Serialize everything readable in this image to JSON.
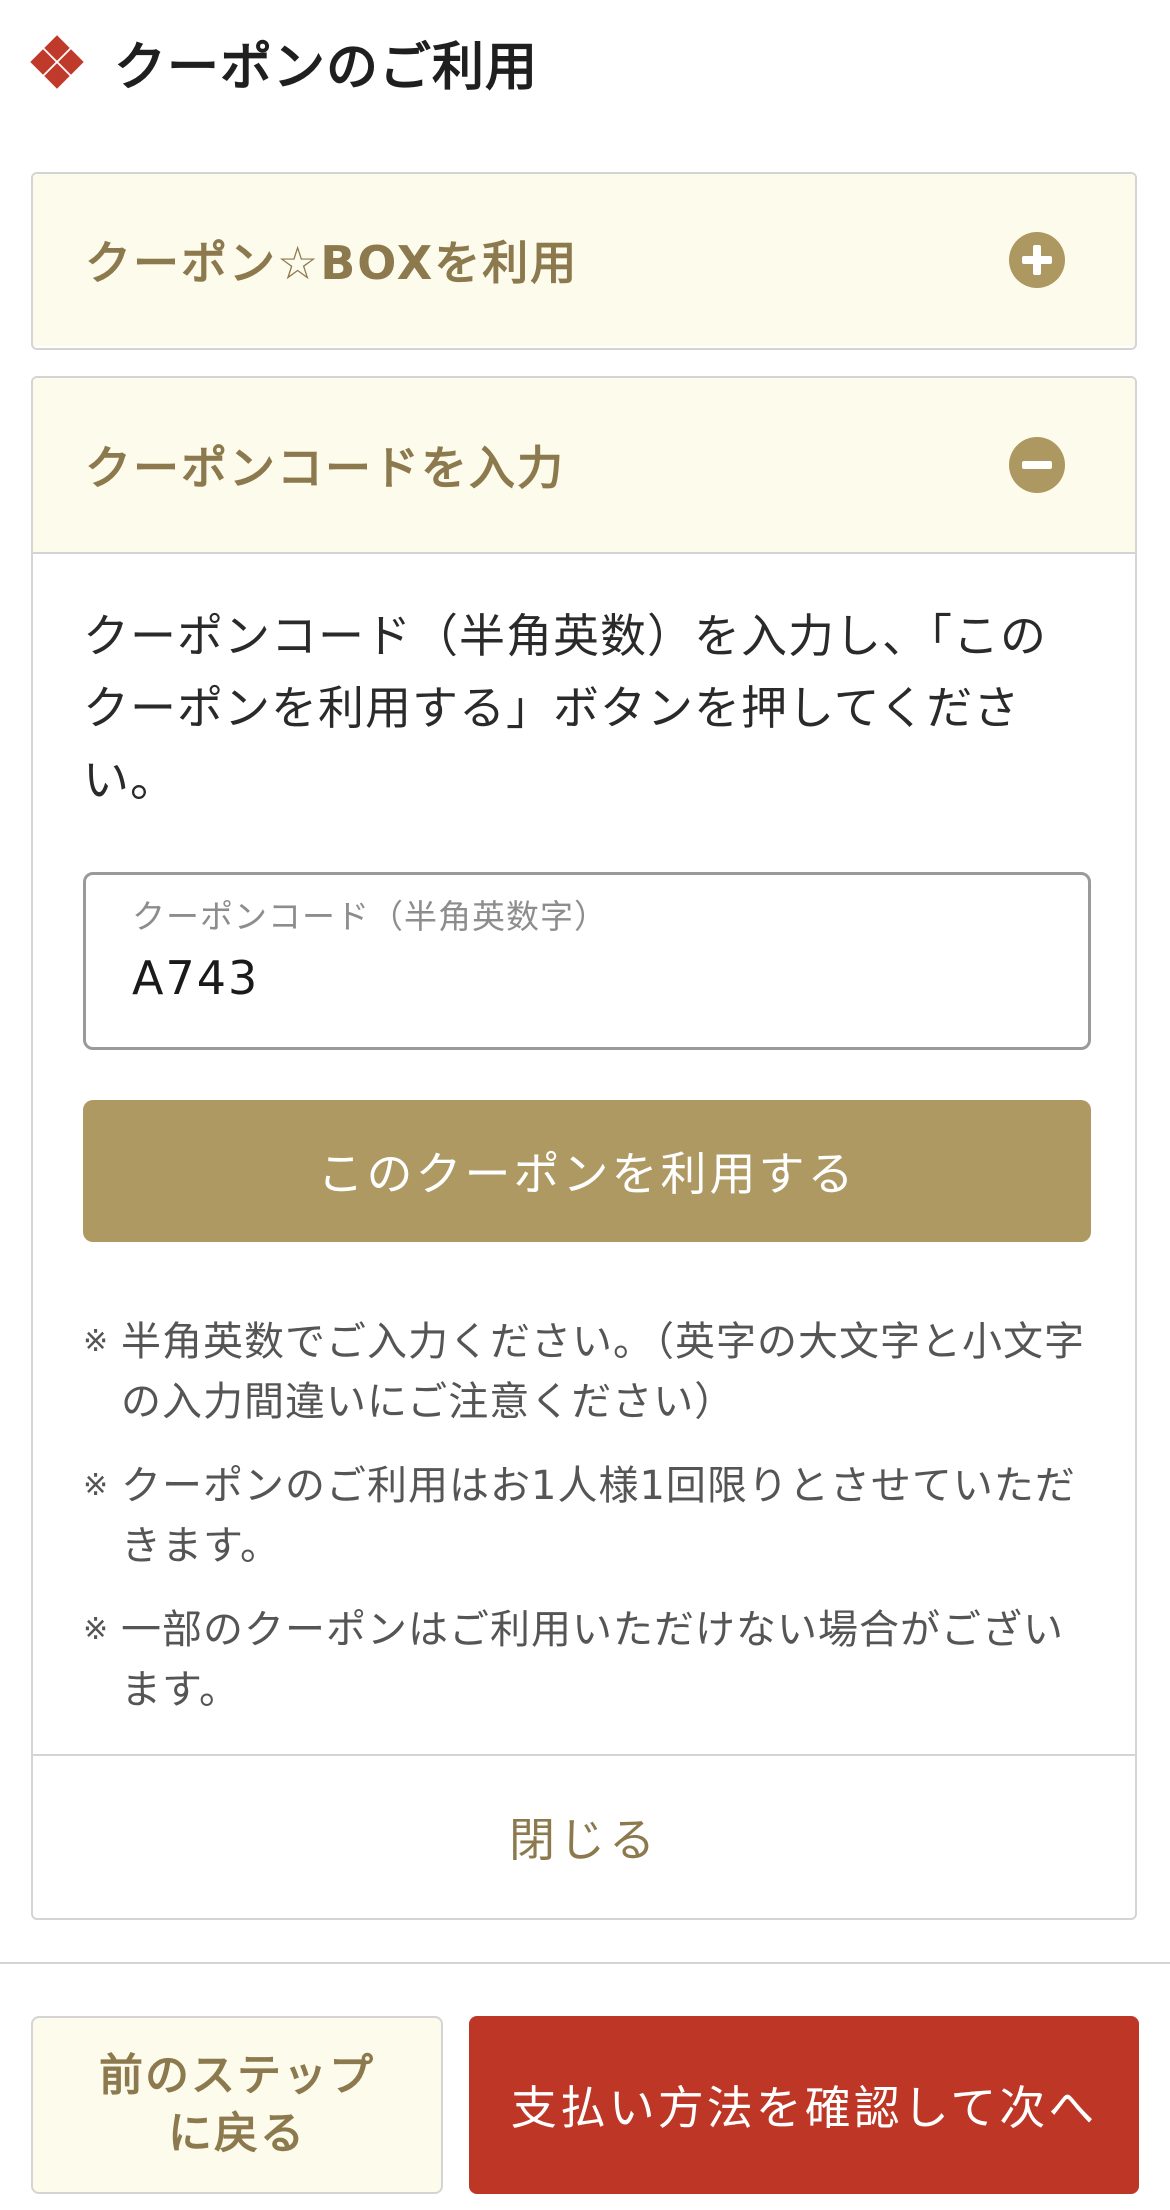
{
  "header": {
    "title": "クーポンのご利用",
    "icon": "diamond-cluster-icon"
  },
  "colors": {
    "accent_gold": "#af9963",
    "header_text_gold": "#8c7a4e",
    "panel_bg": "#fdfbec",
    "primary_red": "#bd3626",
    "brand_diamond": "#bf3a2b"
  },
  "coupon_box": {
    "title": "クーポン☆BOXを利用",
    "toggle_icon": "plus-circle-icon",
    "expanded": false
  },
  "coupon_code": {
    "title": "クーポンコードを入力",
    "toggle_icon": "minus-circle-icon",
    "expanded": true,
    "instruction": "クーポンコード（半角英数）を入力し、「このクーポンを利用する」ボタンを押してください。",
    "field_label": "クーポンコード（半角英数字）",
    "field_value": "A743",
    "apply_label": "このクーポンを利用する",
    "notes": [
      {
        "mark": "※",
        "text": "半角英数でご入力ください。（英字の大文字と小文字の入力間違いにご注意ください）"
      },
      {
        "mark": "※",
        "text": "クーポンのご利用はお1人様1回限りとさせていただきます。"
      },
      {
        "mark": "※",
        "text": "一部のクーポンはご利用いただけない場合がございます。"
      }
    ],
    "close_label": "閉じる"
  },
  "footer": {
    "back_label": "前のステップ\nに戻る",
    "next_label": "支払い方法を確認して次へ"
  }
}
